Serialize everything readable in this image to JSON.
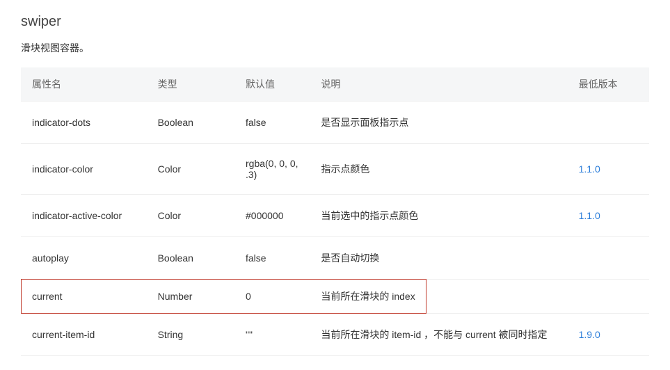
{
  "title": "swiper",
  "subtitle": "滑块视图容器。",
  "columns": {
    "property": "属性名",
    "type": "类型",
    "default": "默认值",
    "description": "说明",
    "minVersion": "最低版本"
  },
  "rows": [
    {
      "property": "indicator-dots",
      "type": "Boolean",
      "default": "false",
      "description": "是否显示面板指示点",
      "minVersion": "",
      "highlighted": false
    },
    {
      "property": "indicator-color",
      "type": "Color",
      "default": "rgba(0, 0, 0, .3)",
      "description": "指示点颜色",
      "minVersion": "1.1.0",
      "highlighted": false
    },
    {
      "property": "indicator-active-color",
      "type": "Color",
      "default": "#000000",
      "description": "当前选中的指示点颜色",
      "minVersion": "1.1.0",
      "highlighted": false
    },
    {
      "property": "autoplay",
      "type": "Boolean",
      "default": "false",
      "description": "是否自动切换",
      "minVersion": "",
      "highlighted": false
    },
    {
      "property": "current",
      "type": "Number",
      "default": "0",
      "description": "当前所在滑块的 index",
      "minVersion": "",
      "highlighted": true
    },
    {
      "property": "current-item-id",
      "type": "String",
      "default": "\"\"",
      "description": "当前所在滑块的 item-id ，不能与 current 被同时指定",
      "minVersion": "1.9.0",
      "highlighted": false
    }
  ]
}
